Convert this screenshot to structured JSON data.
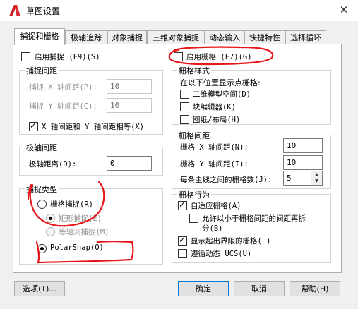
{
  "window": {
    "title": "草图设置",
    "app_icon": "autocad-a-icon",
    "close_glyph": "✕"
  },
  "tabs": [
    {
      "label": "捕捉和栅格",
      "active": true
    },
    {
      "label": "极轴追踪",
      "active": false
    },
    {
      "label": "对象捕捉",
      "active": false
    },
    {
      "label": "三维对象捕捉",
      "active": false
    },
    {
      "label": "动态输入",
      "active": false
    },
    {
      "label": "快捷特性",
      "active": false
    },
    {
      "label": "选择循环",
      "active": false
    }
  ],
  "snap": {
    "enable_label": "启用捕捉 (F9)(S)",
    "enabled": false,
    "spacing_title": "捕捉间距",
    "x_label": "捕捉 X 轴间距(P):",
    "x_value": "10",
    "y_label": "捕捉 Y 轴间距(C):",
    "y_value": "10",
    "equal_label": "X 轴间距和 Y 轴间距相等(X)",
    "equal_checked": true
  },
  "polar": {
    "title": "极轴间距",
    "distance_label": "极轴距离(D):",
    "distance_value": "0"
  },
  "snap_type": {
    "title": "捕捉类型",
    "grid_snap_label": "栅格捕捉(R)",
    "rect_snap_label": "矩形捕捉(E)",
    "iso_snap_label": "等轴测捕捉(M)",
    "polar_snap_label": "PolarSnap(O)",
    "selected": "PolarSnap"
  },
  "grid": {
    "enable_label": "启用栅格 (F7)(G)",
    "enabled": false
  },
  "grid_style": {
    "title": "栅格样式",
    "subtitle": "在以下位置显示点栅格:",
    "model_label": "二维模型空间(D)",
    "block_editor_label": "块编辑器(K)",
    "sheet_layout_label": "图纸/布局(H)"
  },
  "grid_spacing": {
    "title": "栅格间距",
    "x_label": "栅格 X 轴间距(N):",
    "x_value": "10",
    "y_label": "栅格 Y 轴间距(I):",
    "y_value": "10",
    "major_label": "每条主线之间的栅格数(J):",
    "major_value": "5"
  },
  "grid_behavior": {
    "title": "栅格行为",
    "adaptive_label": "自适应栅格(A)",
    "adaptive_checked": true,
    "subdivide_label_line1": "允许以小于栅格间距的间距再拆",
    "subdivide_label_line2": "分(B)",
    "subdivide_checked": false,
    "beyond_limits_label": "显示超出界限的栅格(L)",
    "beyond_limits_checked": true,
    "follow_ucs_label": "遵循动态 UCS(U)",
    "follow_ucs_checked": false
  },
  "buttons": {
    "options": "选项(T)...",
    "ok": "确定",
    "cancel": "取消",
    "help": "帮助(H)"
  },
  "colors": {
    "annotation": "#e8161b",
    "app_icon": "#c8181e"
  }
}
